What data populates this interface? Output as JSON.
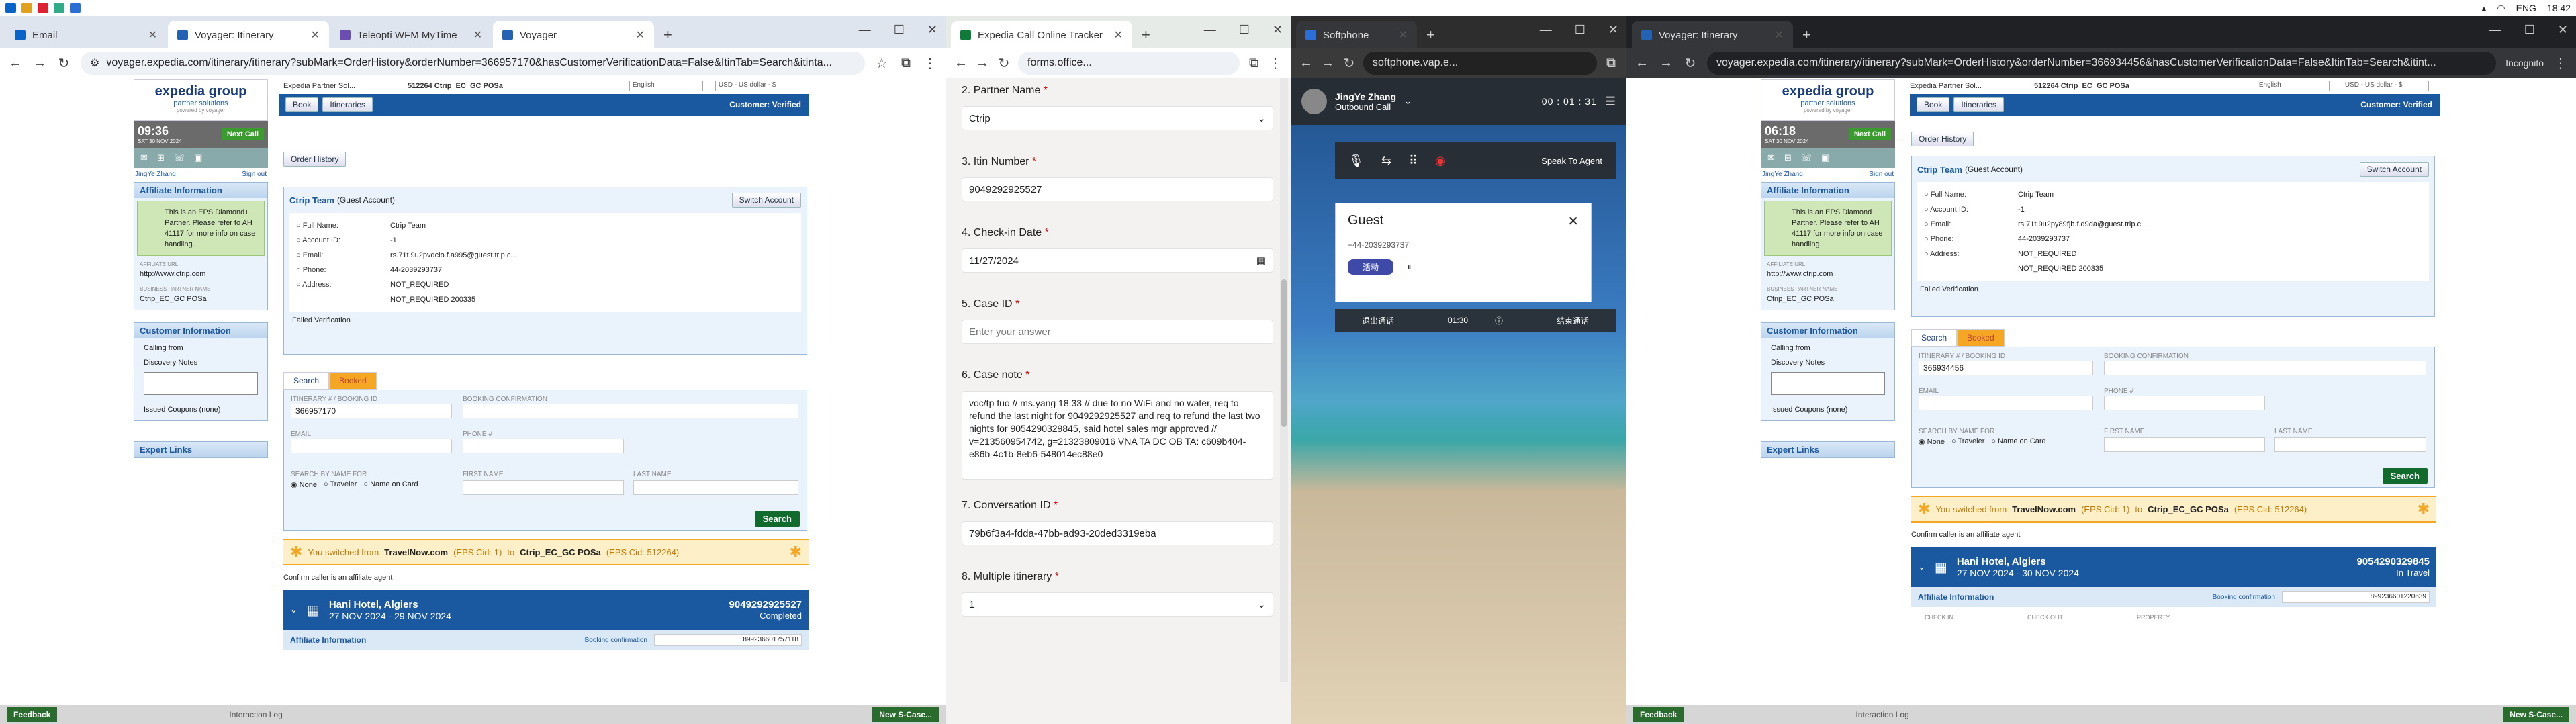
{
  "system": {
    "lang": "ENG",
    "time": "18:42"
  },
  "win1": {
    "tabs": [
      {
        "label": "Email",
        "color": "#0a64c8"
      },
      {
        "label": "Voyager: Itinerary",
        "color": "#2463b4"
      },
      {
        "label": "Teleopti WFM MyTime",
        "color": "#6a4fb0"
      },
      {
        "label": "Voyager",
        "color": "#2463b4"
      }
    ],
    "url": "voyager.expedia.com/itinerary/itinerary?subMark=OrderHistory&orderNumber=366957170&hasCustomerVerificationData=False&ItinTab=Search&itinta..."
  },
  "vh1": {
    "partner": "Expedia Partner Sol...",
    "tpid": "512264 Ctrip_EC_GC POSa",
    "lang": "English",
    "currency": "USD - US dollar - $",
    "book": "Book",
    "itineraries": "Itineraries",
    "verified": "Customer: Verified",
    "order_history": "Order History",
    "logo1": "expedia group",
    "logo2": "partner solutions",
    "logo3": "powered by voyager",
    "clock": "09:36",
    "clock_date": "SAT 30 NOV 2024",
    "next_call": "Next Call",
    "agent": "JingYe Zhang",
    "sign_out": "Sign out",
    "aff_title": "Affiliate Information",
    "aff_note": "This is an EPS Diamond+ Partner. Please refer to AH 41117 for more info on case handling.",
    "aff_url_label": "AFFILIATE URL",
    "aff_url": "http://www.ctrip.com",
    "bp_label": "BUSINESS PARTNER NAME",
    "bp_name": "Ctrip_EC_GC POSa",
    "ci_title": "Customer Information",
    "calling_from": "Calling from",
    "notes": "Discovery Notes",
    "coupons": "Issued Coupons (none)",
    "expert": "Expert Links",
    "acct_title": "Ctrip Team",
    "acct_sub": "(Guest Account)",
    "switch_acct": "Switch Account",
    "fields": [
      {
        "k": "Full Name:",
        "v": "Ctrip Team"
      },
      {
        "k": "Account ID:",
        "v": "-1"
      },
      {
        "k": "Email:",
        "v": "rs.71t.9u2pvdcio.f.a995@guest.trip.c..."
      },
      {
        "k": "Phone:",
        "v": "44-2039293737"
      },
      {
        "k": "Address:",
        "v": "NOT_REQUIRED"
      },
      {
        "k": "",
        "v": "NOT_REQUIRED 200335"
      }
    ],
    "failed": "Failed Verification",
    "search_tab": "Search",
    "booked_tab": "Booked",
    "itin_label": "ITINERARY # / BOOKING ID",
    "itin_val": "366957170",
    "conf_label": "BOOKING CONFIRMATION",
    "email_label": "EMAIL",
    "phone_label": "PHONE #",
    "name_label": "SEARCH BY NAME FOR",
    "r1": "None",
    "r2": "Traveler",
    "r3": "Name on Card",
    "first": "FIRST NAME",
    "last": "LAST NAME",
    "search_btn": "Search",
    "switch_prefix": "You switched from",
    "switch_from": "TravelNow.com",
    "switch_from_cid": "(EPS Cid: 1)",
    "switch_to_word": "to",
    "switch_to": "Ctrip_EC_GC POSa",
    "switch_to_cid": "(EPS Cid: 512264)",
    "confirm": "Confirm caller is an affiliate agent",
    "hotel_name": "Hani Hotel, Algiers",
    "hotel_dates": "27 NOV 2024 - 29 NOV 2024",
    "hotel_itin": "9049292925527",
    "hotel_status": "Completed",
    "aff_info2": "Affiliate Information",
    "booking_conf": "Booking confirmation",
    "booking_num": "899236601757118",
    "feedback": "Feedback",
    "interaction": "Interaction Log",
    "new_case": "New S-Case..."
  },
  "win2": {
    "tabs": [
      {
        "label": "Expedia Call Online Tracker",
        "color": "#0f7b3a"
      }
    ],
    "url": "forms.office..."
  },
  "form": {
    "questions": [
      {
        "n": "2. Partner Name",
        "val": "Ctrip",
        "type": "select"
      },
      {
        "n": "3. Itin Number",
        "val": "9049292925527",
        "type": "text"
      },
      {
        "n": "4. Check-in Date",
        "val": "11/27/2024",
        "type": "date"
      },
      {
        "n": "5. Case ID",
        "val": "Enter your answer",
        "type": "placeholder"
      },
      {
        "n": "6. Case note",
        "val": "voc/tp fuo // ms.yang 18.33 // due to no WiFi and no water, req to refund the last night for 9049292925527 and req to refund the last two nights for 9054290329845, said hotel sales mgr approved // v=213560954742, g=21323809016 VNA TA DC OB TA: c609b404-e86b-4c1b-8eb6-548014ec88e0",
        "type": "area"
      },
      {
        "n": "7. Conversation ID",
        "val": "79b6f3a4-fdda-47bb-ad93-20ded3319eba",
        "type": "text"
      },
      {
        "n": "8. Multiple itinerary",
        "val": "1",
        "type": "select"
      }
    ]
  },
  "win3": {
    "tabs": [
      {
        "label": "Softphone",
        "color": "#2b6fd6"
      }
    ],
    "url": "softphone.vap.e..."
  },
  "phone": {
    "agent": "JingYe Zhang",
    "status": "Outbound Call",
    "timer": "00 : 01 : 31",
    "speak_agent": "Speak To Agent",
    "caller": "Guest",
    "number": "+44-2039293737",
    "active": "活动",
    "exit": "退出通话",
    "time2": "01:30",
    "end": "结束通话"
  },
  "win4": {
    "tabs": [
      {
        "label": "Voyager: Itinerary",
        "color": "#2463b4"
      }
    ],
    "url": "voyager.expedia.com/itinerary/itinerary?subMark=OrderHistory&orderNumber=366934456&hasCustomerVerificationData=False&ItinTab=Search&itint...",
    "incognito": "Incognito"
  },
  "vh2": {
    "tpid": "512264 Ctrip_EC_GC POSa",
    "clock": "06:18",
    "clock_date": "SAT 30 NOV 2024",
    "email": "rs.71t.9u2py89fjb.f.d9da@guest.trip.c...",
    "itin_val": "366934456",
    "hotel_name": "Hani Hotel, Algiers",
    "hotel_dates": "27 NOV 2024 - 30 NOV 2024",
    "hotel_itin": "9054290329845",
    "hotel_status": "In Travel",
    "booking_num": "899236601220639",
    "checkin": "CHECK IN",
    "checkout": "CHECK OUT",
    "property": "PROPERTY"
  }
}
